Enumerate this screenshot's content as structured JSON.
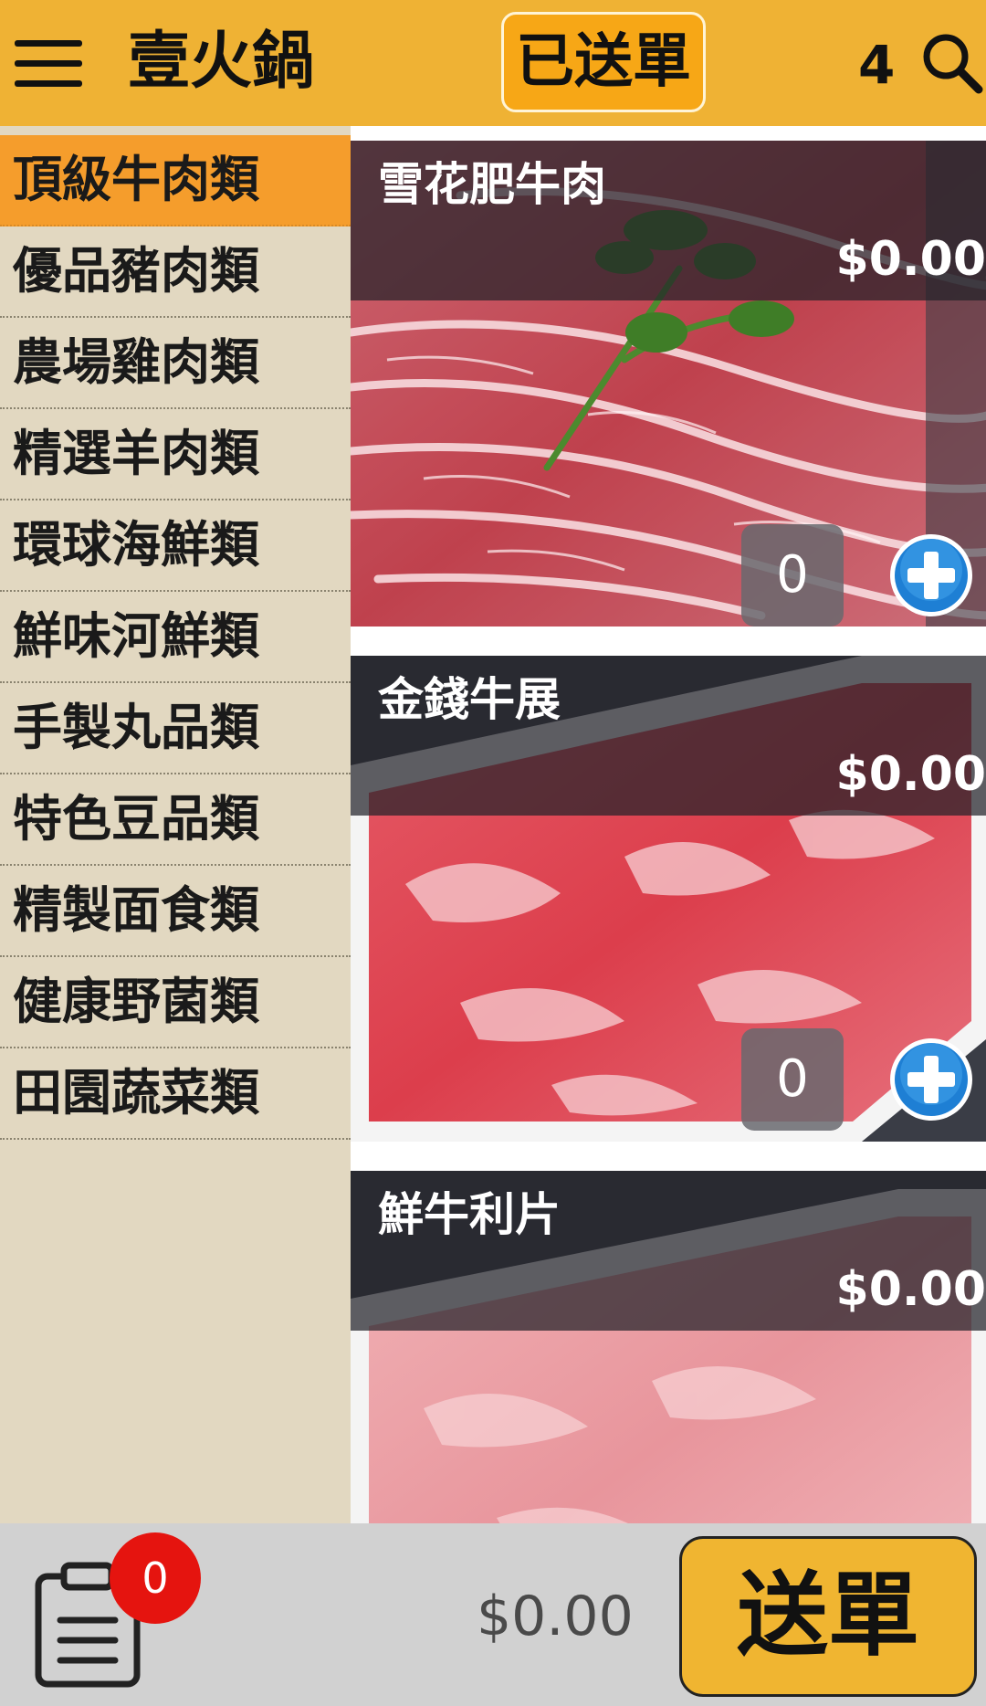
{
  "header": {
    "app_title": "壹火鍋",
    "sent_button_label": "已送單",
    "count": "4",
    "menu_icon": "hamburger-menu-icon",
    "search_icon": "search-icon",
    "background_color": "#efb234"
  },
  "categories": {
    "items": [
      {
        "label": "頂級牛肉類",
        "active": true
      },
      {
        "label": "優品豬肉類",
        "active": false
      },
      {
        "label": "農場雞肉類",
        "active": false
      },
      {
        "label": "精選羊肉類",
        "active": false
      },
      {
        "label": "環球海鮮類",
        "active": false
      },
      {
        "label": "鮮味河鮮類",
        "active": false
      },
      {
        "label": "手製丸品類",
        "active": false
      },
      {
        "label": "特色豆品類",
        "active": false
      },
      {
        "label": "精製面食類",
        "active": false
      },
      {
        "label": "健康野菌類",
        "active": false
      },
      {
        "label": "田園蔬菜類",
        "active": false
      }
    ],
    "active_color": "#f59d2c"
  },
  "products": [
    {
      "name": "雪花肥牛肉",
      "price": "$0.00",
      "quantity": "0",
      "add_icon": "plus-circle-icon"
    },
    {
      "name": "金錢牛展",
      "price": "$0.00",
      "quantity": "0",
      "add_icon": "plus-circle-icon"
    },
    {
      "name": "鮮牛利片",
      "price": "$0.00"
    }
  ],
  "footer": {
    "cart_icon": "clipboard-list-icon",
    "cart_badge": "0",
    "total": "$0.00",
    "submit_label": "送單",
    "badge_color": "#e5140f"
  }
}
